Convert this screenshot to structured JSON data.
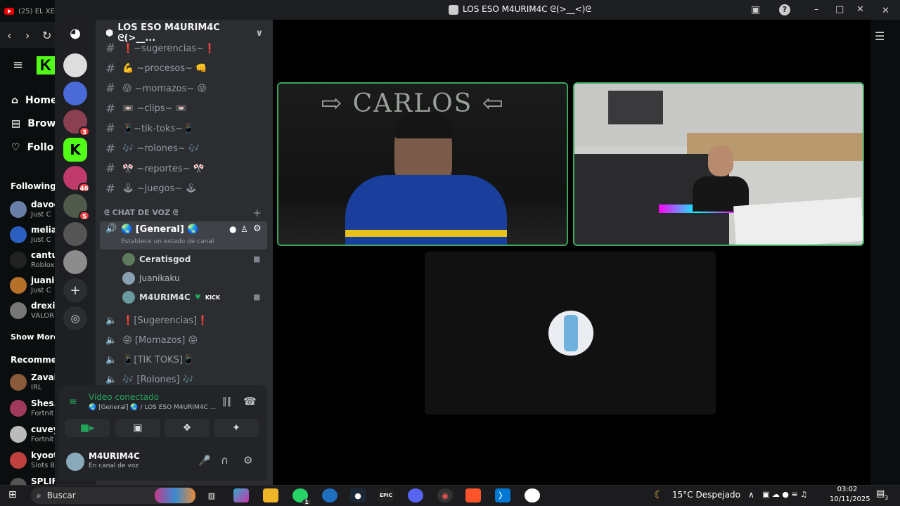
{
  "browser": {
    "tab_title": "(25) EL XE",
    "sidebar": {
      "home": "Home",
      "browse": "Brow",
      "following": "Follo",
      "following_section": "Following",
      "recommended_section": "Recommen",
      "show_more": "Show More",
      "followed": [
        {
          "name": "davoo",
          "status": "Just C"
        },
        {
          "name": "melia",
          "status": "Just C"
        },
        {
          "name": "cantu",
          "status": "Roblox"
        },
        {
          "name": "juani",
          "status": "Just C"
        },
        {
          "name": "drexit",
          "status": "VALOR"
        }
      ],
      "recommended": [
        {
          "name": "Zaval",
          "status": "IRL"
        },
        {
          "name": "Shes.",
          "status": "Fortnit"
        },
        {
          "name": "cuvey",
          "status": "Fortnit"
        },
        {
          "name": "kyoot",
          "status": "Slots 8"
        },
        {
          "name": "SPLIF",
          "status": ""
        }
      ]
    }
  },
  "discord": {
    "window_title": "LOS ESO M4URIM4C ᘓ(>__<)ᘓ",
    "server_name": "LOS ESO M4URIM4C ᘓ(>__...",
    "guild_badges": [
      "3",
      "46",
      "5"
    ],
    "text_channels": [
      "❗~sugerencias~❗",
      "💪 ~procesos~ 👊",
      "😝 ~momazos~ 😝",
      "📼 ~clips~ 📼",
      "📱~tik-toks~📱",
      "🎶 ~rolones~ 🎶",
      "🎌 ~reportes~ 🎌",
      "🕹 ~juegos~ 🕹"
    ],
    "voice_category": "ᘓ CHAT DE VOZ ᘓ",
    "active_voice": {
      "name": "🌏 [General] 🌏",
      "status": "Establece un estado de canal"
    },
    "voice_users": [
      {
        "name": "Ceratisgod",
        "badge": ""
      },
      {
        "name": "Juanikaku",
        "badge": ""
      },
      {
        "name": "M4URIM4C",
        "badge": "KICK"
      }
    ],
    "voice_channels": [
      "❗[Sugerencias]❗",
      "😝 [Momazos] 😝",
      "📱[TIK TOKS]📱",
      "🎶 [Rolones] 🎶"
    ],
    "rtc": {
      "status": "Video conectado",
      "location": "🌏 [General] 🌏 / LOS ESO M4URIM4C ..."
    },
    "user": {
      "name": "M4URIM4C",
      "status": "En canal de voz"
    },
    "webcam1_text": "⇨ CARLOS ⇦"
  },
  "taskbar": {
    "search_placeholder": "Buscar",
    "weather": "15°C  Despejado",
    "time": "03:02",
    "date": "10/11/2025",
    "notification_count": "3",
    "whatsapp_badge": "1"
  },
  "colors": {
    "kick_green": "#53fc18",
    "discord_green": "#3ba55d",
    "discord_bg": "#2b2d31"
  }
}
